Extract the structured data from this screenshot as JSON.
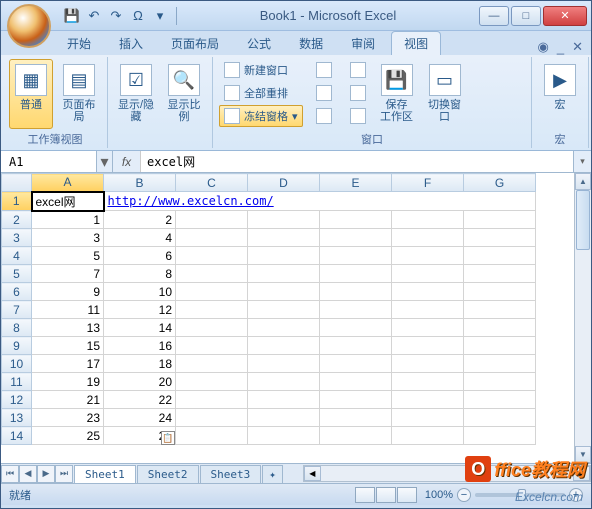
{
  "title": "Book1 - Microsoft Excel",
  "tabs": [
    "开始",
    "插入",
    "页面布局",
    "公式",
    "数据",
    "审阅",
    "视图"
  ],
  "active_tab": "视图",
  "ribbon": {
    "group1": {
      "label": "工作簿视图",
      "b1": "普通",
      "b2": "页面布局"
    },
    "group2": {
      "b1": "显示/隐藏",
      "b2": "显示比例"
    },
    "group3": {
      "label": "窗口",
      "s1": "新建窗口",
      "s2": "全部重排",
      "s3": "冻结窗格",
      "b1": "保存\n工作区",
      "b2": "切换窗口"
    },
    "group4": {
      "label": "宏",
      "b1": "宏"
    }
  },
  "namebox": "A1",
  "formula": "excel网",
  "cols": [
    "A",
    "B",
    "C",
    "D",
    "E",
    "F",
    "G"
  ],
  "rows": [
    {
      "n": 1,
      "a": "excel网",
      "b": "http://www.excelcn.com/"
    },
    {
      "n": 2,
      "a": "1",
      "b": "2"
    },
    {
      "n": 3,
      "a": "3",
      "b": "4"
    },
    {
      "n": 4,
      "a": "5",
      "b": "6"
    },
    {
      "n": 5,
      "a": "7",
      "b": "8"
    },
    {
      "n": 6,
      "a": "9",
      "b": "10"
    },
    {
      "n": 7,
      "a": "11",
      "b": "12"
    },
    {
      "n": 8,
      "a": "13",
      "b": "14"
    },
    {
      "n": 9,
      "a": "15",
      "b": "16"
    },
    {
      "n": 10,
      "a": "17",
      "b": "18"
    },
    {
      "n": 11,
      "a": "19",
      "b": "20"
    },
    {
      "n": 12,
      "a": "21",
      "b": "22"
    },
    {
      "n": 13,
      "a": "23",
      "b": "24"
    },
    {
      "n": 14,
      "a": "25",
      "b": "26"
    }
  ],
  "sheets": [
    "Sheet1",
    "Sheet2",
    "Sheet3"
  ],
  "status": "就绪",
  "zoom": "100%",
  "wm1": "ffice教程网",
  "wm2": "Excelcn.com"
}
